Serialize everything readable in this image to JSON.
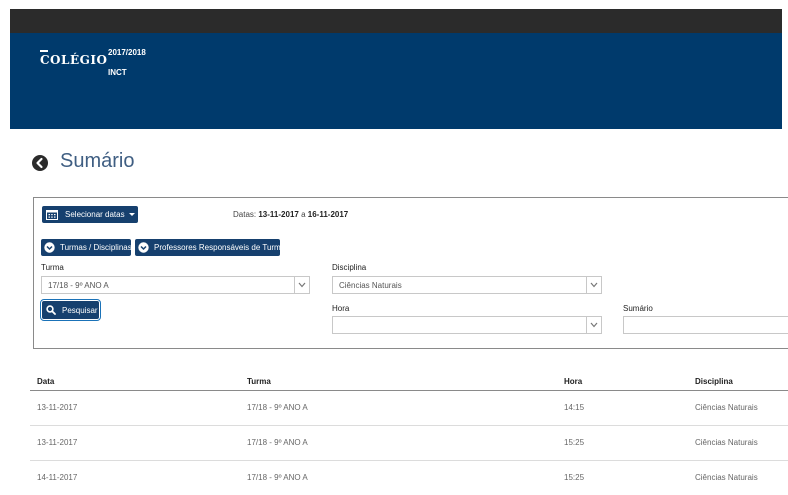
{
  "header": {
    "logo_text": "COLÉGIO",
    "school_year": "2017/2018",
    "institution": "INCT"
  },
  "page": {
    "title": "Sumário"
  },
  "filters": {
    "select_dates_label": "Selecionar datas",
    "dates_prefix": "Datas:",
    "date_from": "13-11-2017",
    "dates_sep": "a",
    "date_to": "16-11-2017",
    "turmas_button": "Turmas / Disciplinas",
    "professores_button": "Professores Responsáveis de Turma",
    "turma_label": "Turma",
    "turma_value": "17/18 - 9º ANO A",
    "disciplina_label": "Disciplina",
    "disciplina_value": "Ciências Naturais",
    "hora_label": "Hora",
    "hora_value": "",
    "sumario_label": "Sumário",
    "sumario_value": "",
    "search_button": "Pesquisar"
  },
  "table": {
    "columns": [
      "Data",
      "Turma",
      "Hora",
      "Disciplina"
    ],
    "rows": [
      [
        "13-11-2017",
        "17/18 - 9º ANO A",
        "14:15",
        "Ciências Naturais"
      ],
      [
        "13-11-2017",
        "17/18 - 9º ANO A",
        "15:25",
        "Ciências Naturais"
      ],
      [
        "14-11-2017",
        "17/18 - 9º ANO A",
        "15:25",
        "Ciências Naturais"
      ]
    ]
  },
  "colors": {
    "header_bg": "#003a6c",
    "topbar_bg": "#2b2b2b",
    "button_bg": "#16406e",
    "title_color": "#3f5e82"
  },
  "icons": {
    "back": "chevron-left-circle-icon",
    "calendar": "calendar-icon",
    "toggle": "chevron-down-circle-icon",
    "search": "search-icon",
    "select_arrow": "chevron-down-icon"
  }
}
